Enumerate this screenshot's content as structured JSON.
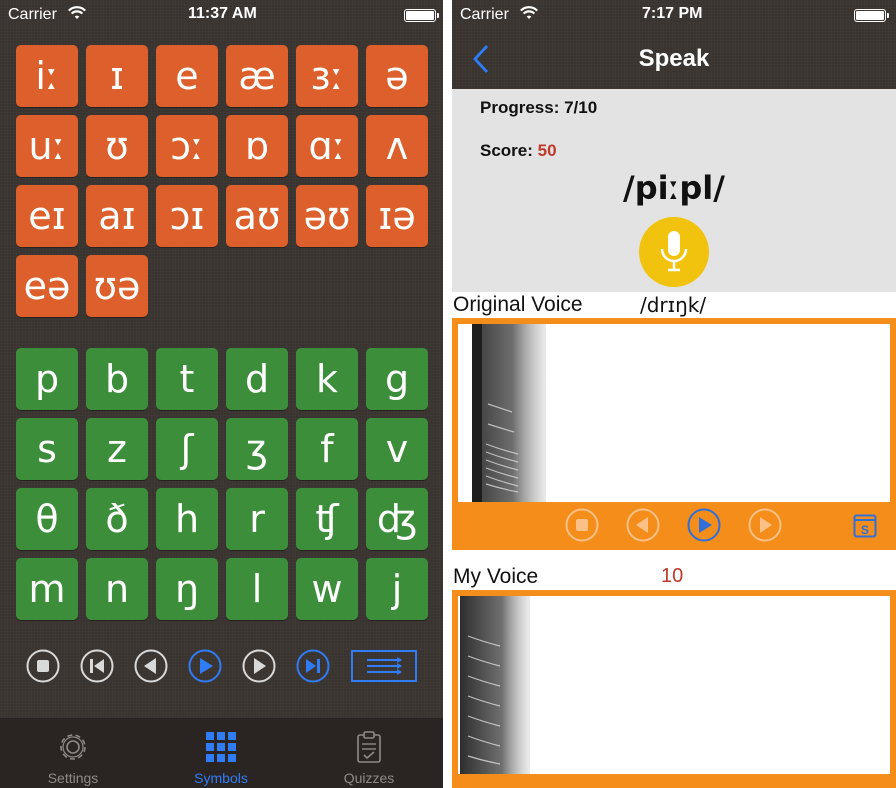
{
  "left": {
    "status": {
      "carrier": "Carrier",
      "time": "11:37 AM"
    },
    "vowels": [
      "iː",
      "ɪ",
      "e",
      "æ",
      "ɜː",
      "ə",
      "uː",
      "ʊ",
      "ɔː",
      "ɒ",
      "ɑː",
      "ʌ",
      "eɪ",
      "aɪ",
      "ɔɪ",
      "aʊ",
      "əʊ",
      "ɪə",
      "eə",
      "ʊə"
    ],
    "consonants": [
      "p",
      "b",
      "t",
      "d",
      "k",
      "g",
      "s",
      "z",
      "ʃ",
      "ʒ",
      "f",
      "v",
      "θ",
      "ð",
      "h",
      "r",
      "ʧ",
      "ʤ",
      "m",
      "n",
      "ŋ",
      "l",
      "w",
      "j"
    ],
    "controls": [
      "stop-icon",
      "skip-back-icon",
      "previous-icon",
      "play-icon",
      "next-icon",
      "skip-forward-icon",
      "list-icon"
    ],
    "tabs": [
      {
        "label": "Settings",
        "icon": "gear-icon",
        "active": false
      },
      {
        "label": "Symbols",
        "icon": "grid-icon",
        "active": true
      },
      {
        "label": "Quizzes",
        "icon": "clipboard-icon",
        "active": false
      }
    ]
  },
  "right": {
    "status": {
      "carrier": "Carrier",
      "time": "7:17 PM"
    },
    "nav": {
      "title": "Speak"
    },
    "progress_text": "Progress: 7/10",
    "score_label": "Score:",
    "score_value": "50",
    "word": "/piːpl/",
    "original": {
      "label": "Original Voice",
      "transcription": "/drɪŋk/"
    },
    "mine": {
      "label": "My Voice",
      "score": "10"
    },
    "colors": {
      "accent": "#f58d1b",
      "brand_blue": "#2f7cf6",
      "score_red": "#c0392b",
      "mic_yellow": "#f1c30f"
    }
  }
}
